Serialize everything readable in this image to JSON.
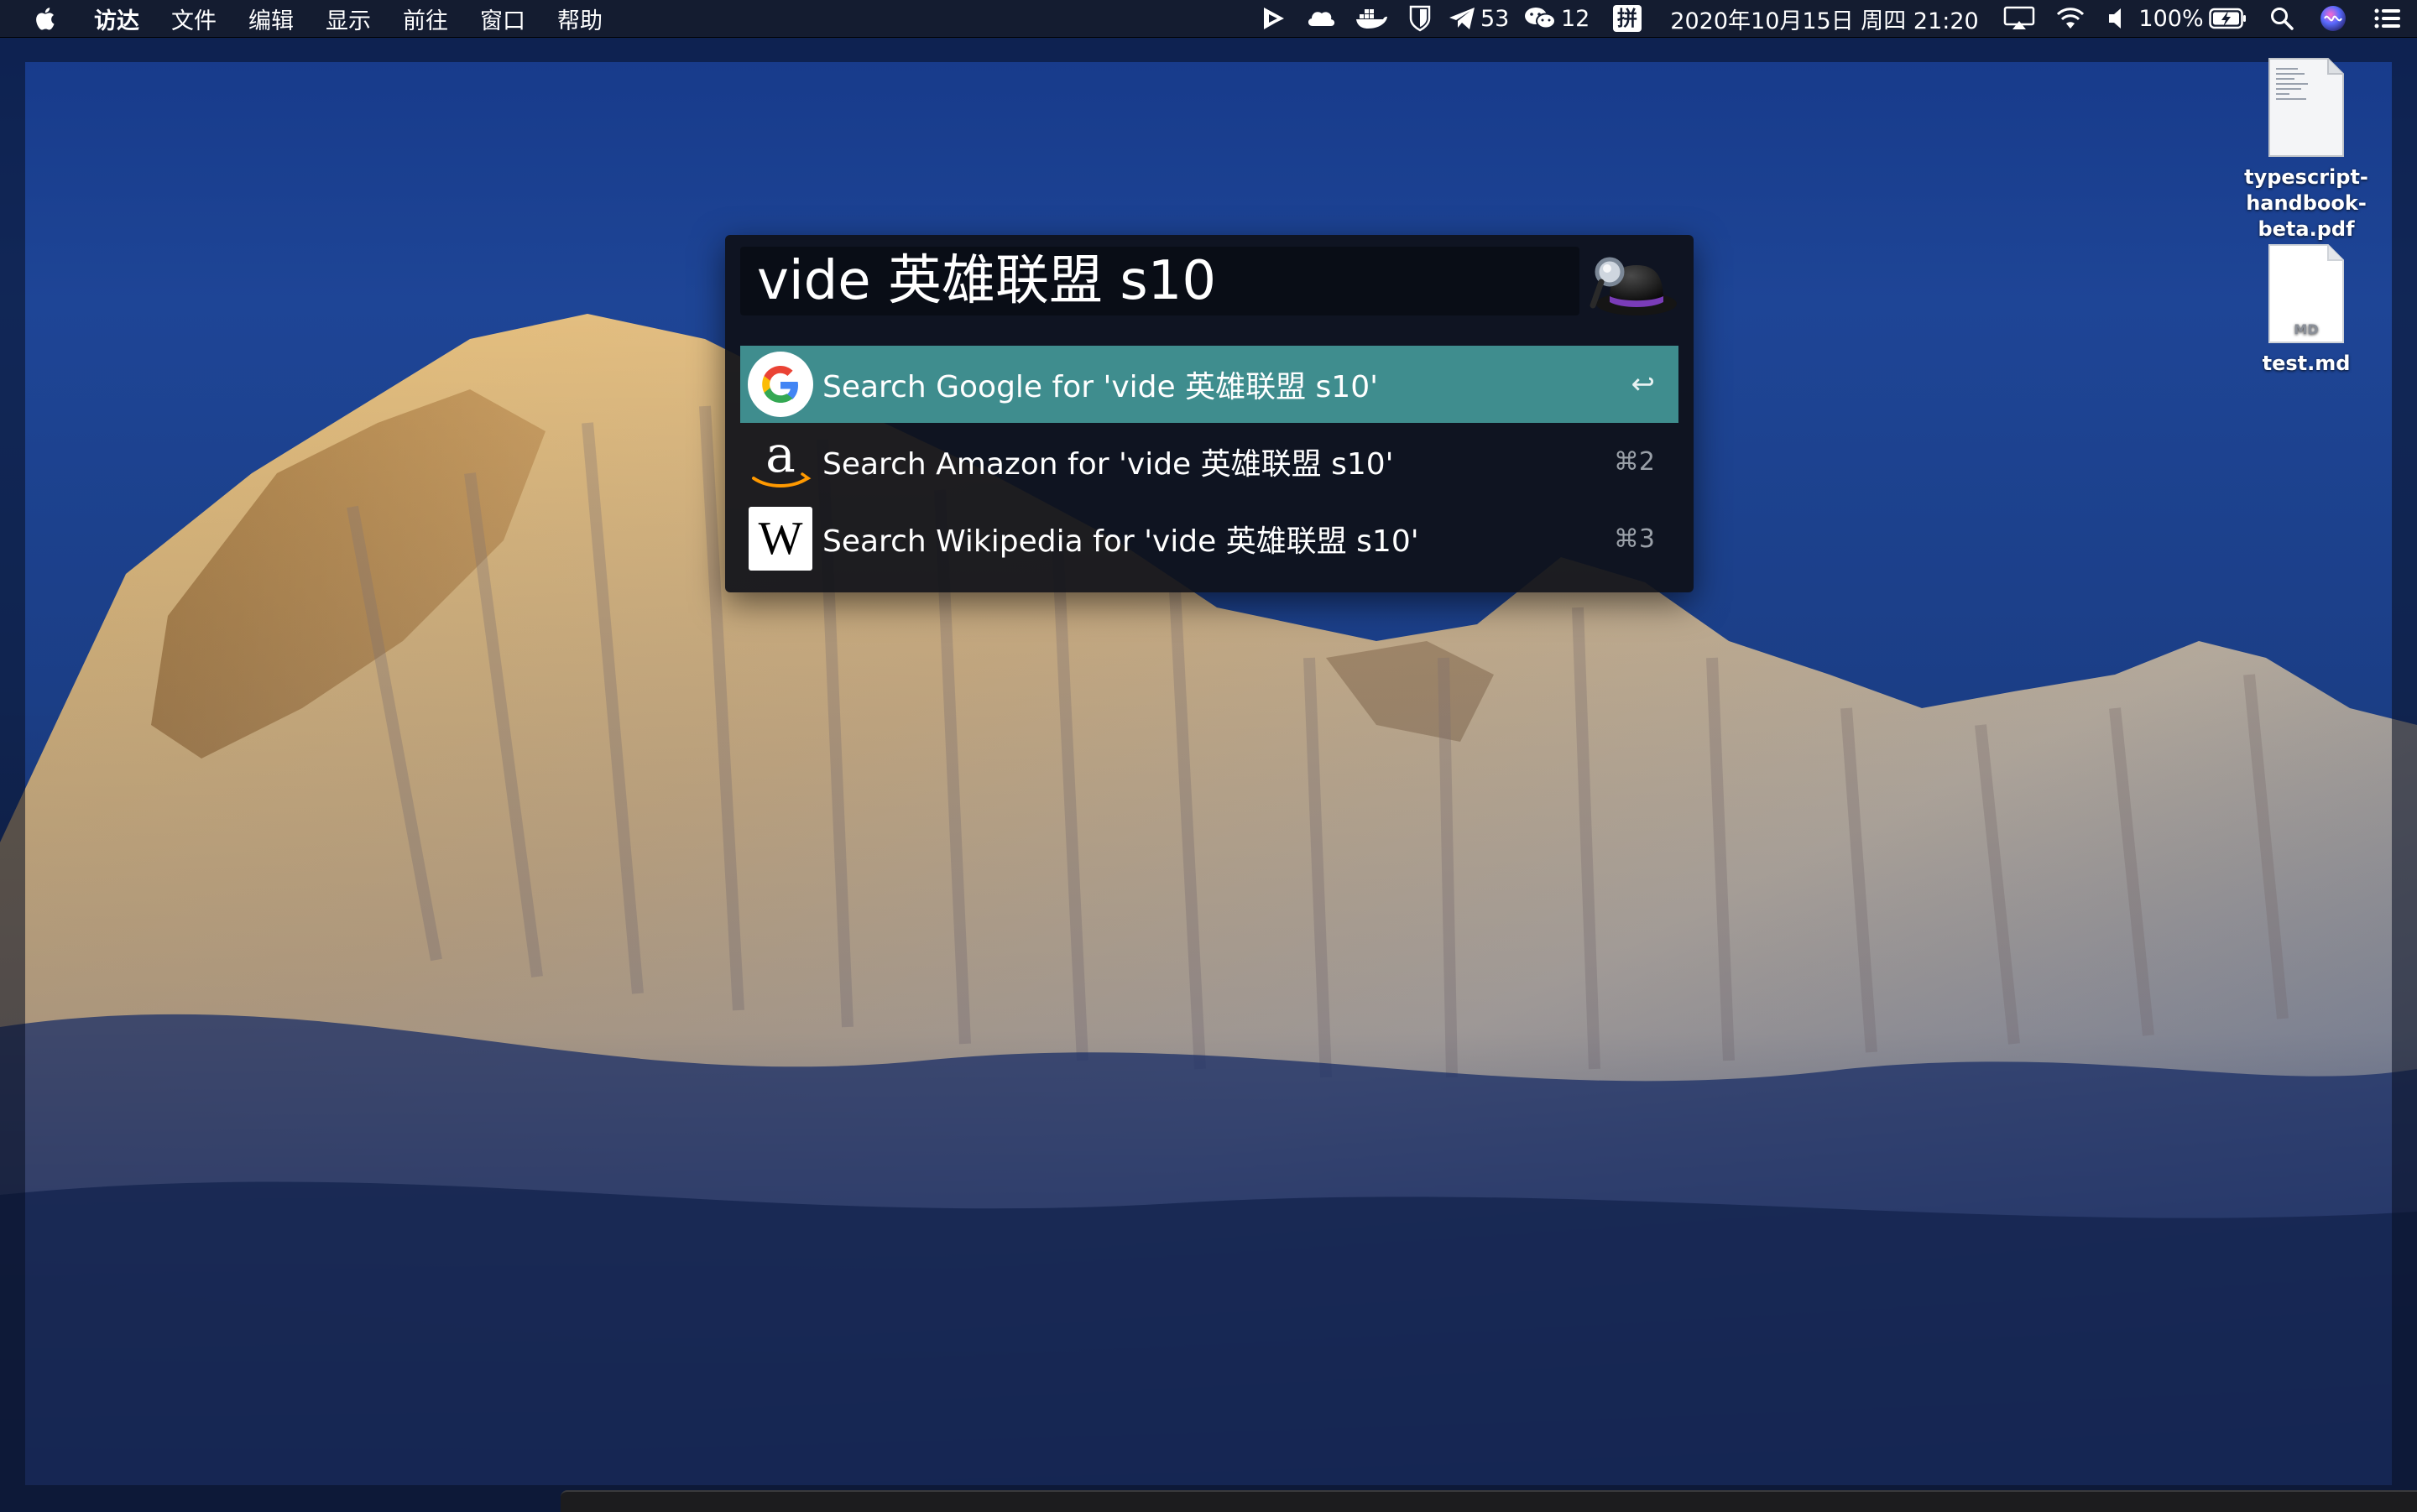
{
  "menubar": {
    "app_menus": [
      "访达",
      "文件",
      "编辑",
      "显示",
      "前往",
      "窗口",
      "帮助"
    ],
    "status": {
      "telegram_count": "53",
      "wechat_count": "12",
      "input_method": "拼",
      "datetime": "2020年10月15日 周四 21:20",
      "battery": "100%"
    },
    "icons": [
      "apple-icon",
      "play-icon",
      "cloud-icon",
      "docker-icon",
      "bitwarden-icon",
      "telegram-icon",
      "wechat-icon",
      "input-method-icon",
      "airplay-icon",
      "wifi-icon",
      "volume-icon",
      "battery-icon",
      "spotlight-icon",
      "siri-icon",
      "control-center-icon"
    ]
  },
  "launcher": {
    "query": "vide 英雄联盟 s10",
    "results": [
      {
        "label": "Search Google for 'vide 英雄联盟 s10'",
        "shortcut": "↩",
        "icon": "google-icon",
        "selected": true
      },
      {
        "label": "Search Amazon for 'vide 英雄联盟 s10'",
        "shortcut": "⌘2",
        "icon": "amazon-icon",
        "selected": false
      },
      {
        "label": "Search Wikipedia for 'vide 英雄联盟 s10'",
        "shortcut": "⌘3",
        "icon": "wikipedia-icon",
        "selected": false
      }
    ],
    "accent": "#3f8d8e"
  },
  "desktop": {
    "files": [
      {
        "name_line1": "typescript-",
        "name_line2": "handbook-beta.pdf",
        "icon": "pdf-file-icon"
      },
      {
        "name_line1": "test.md",
        "icon": "markdown-file-icon",
        "badge": "MD"
      }
    ]
  }
}
